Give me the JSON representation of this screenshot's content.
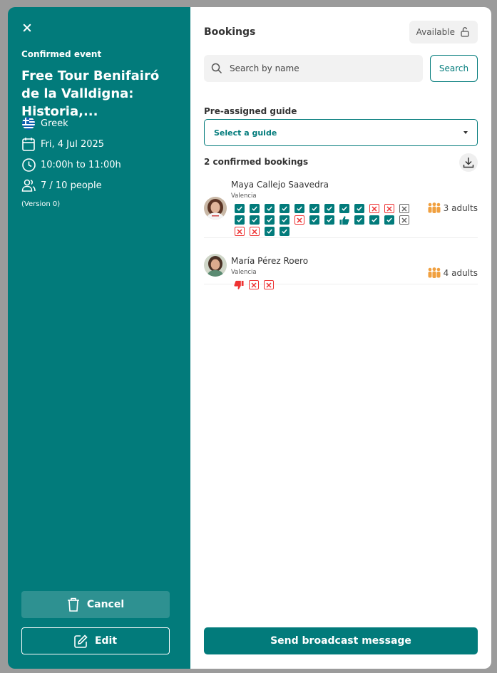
{
  "event": {
    "status": "Confirmed event",
    "title": "Free Tour Benifairó de la Valldigna: Historia,...",
    "language": "Greek",
    "date": "Fri, 4 Jul 2025",
    "time": "10:00h to 11:00h",
    "people": "7 / 10 people",
    "version": "(Version 0)"
  },
  "actions": {
    "cancel": "Cancel",
    "edit": "Edit"
  },
  "bookings_panel": {
    "title": "Bookings",
    "availability": "Available",
    "search_placeholder": "Search by name",
    "search_button": "Search",
    "guide_label": "Pre-assigned guide",
    "guide_select": "Select a guide",
    "count_label": "2 confirmed bookings",
    "broadcast_button": "Send broadcast message"
  },
  "bookings": [
    {
      "name": "Maya Callejo Saavedra",
      "location": "Valencia",
      "people": "3 adults",
      "marks": [
        "ok",
        "ok",
        "ok",
        "ok",
        "ok",
        "ok",
        "ok",
        "ok",
        "ok",
        "no",
        "no",
        "na",
        "ok",
        "ok",
        "ok",
        "ok",
        "no",
        "ok",
        "ok",
        "thumb-up",
        "ok",
        "ok",
        "ok",
        "na",
        "no",
        "no",
        "ok",
        "ok"
      ]
    },
    {
      "name": "María Pérez Roero",
      "location": "Valencia",
      "people": "4 adults",
      "marks": [
        "thumb-down",
        "no",
        "no"
      ]
    }
  ],
  "colors": {
    "brand": "#027b7b",
    "danger": "#e33333",
    "people_icon": "#f0a040"
  }
}
